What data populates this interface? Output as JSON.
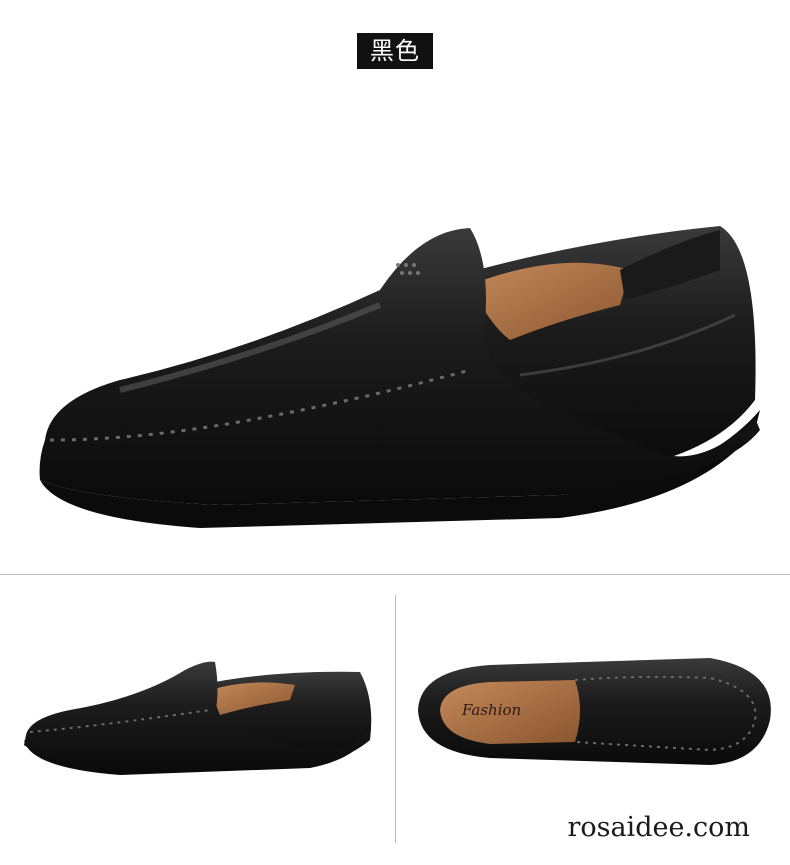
{
  "header": {
    "color_label": "黑色"
  },
  "product": {
    "insole_brand": "Fashion"
  },
  "footer": {
    "watermark": "rosaidee.com"
  }
}
